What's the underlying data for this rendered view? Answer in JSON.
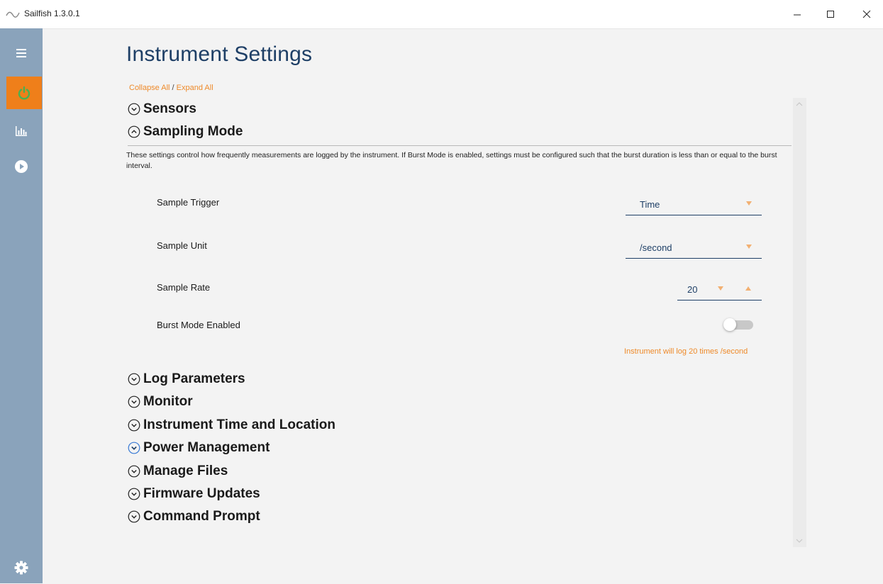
{
  "window": {
    "title": "Sailfish 1.3.0.1"
  },
  "header": {
    "title": "Instrument Settings",
    "collapse_all": "Collapse All",
    "separator": "/",
    "expand_all": "Expand All"
  },
  "sections": {
    "sensors": "Sensors",
    "sampling_mode": "Sampling Mode",
    "log_parameters": "Log Parameters",
    "monitor": "Monitor",
    "time_location": "Instrument Time and Location",
    "power_management": "Power Management",
    "manage_files": "Manage Files",
    "firmware_updates": "Firmware Updates",
    "command_prompt": "Command Prompt"
  },
  "sampling": {
    "description": "These settings control how frequently measurements are logged by the instrument. If Burst Mode is enabled, settings must be configured such that the burst duration is less than or equal to the burst interval.",
    "trigger_label": "Sample Trigger",
    "trigger_value": "Time",
    "unit_label": "Sample Unit",
    "unit_value": "/second",
    "rate_label": "Sample Rate",
    "rate_value": "20",
    "burst_label": "Burst Mode Enabled",
    "burst_enabled": false,
    "summary": "Instrument will log 20 times /second"
  },
  "rail_icons": [
    "menu-icon",
    "power-icon",
    "bar-chart-icon",
    "play-icon",
    "gear-icon"
  ],
  "colors": {
    "accent": "#ef7f1a",
    "rail": "#8aa3bb",
    "title": "#1e3f66",
    "power_green": "#4caf50"
  }
}
